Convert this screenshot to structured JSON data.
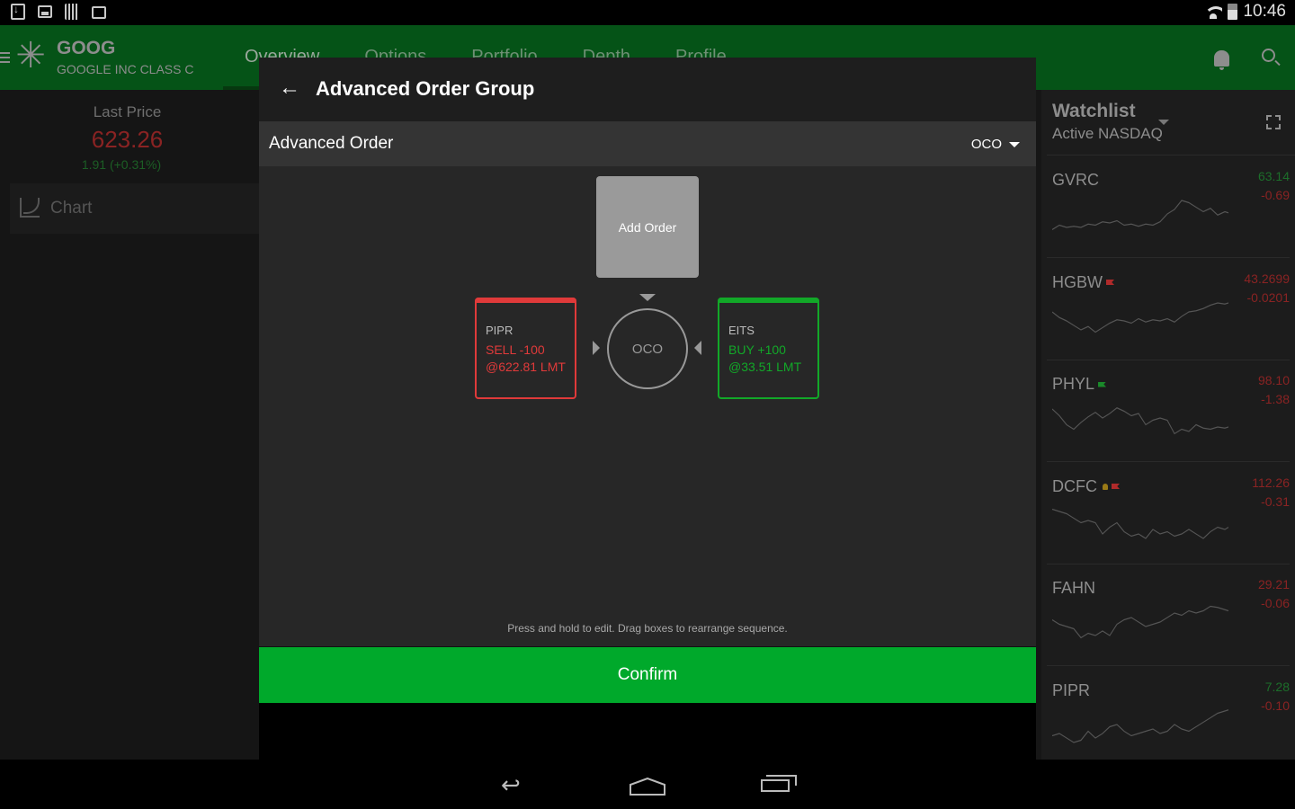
{
  "status_bar": {
    "time": "10:46",
    "left_icons": [
      "download-icon",
      "image-icon",
      "barcode-icon",
      "briefcase-check-icon"
    ],
    "right_icons": [
      "wifi-icon",
      "battery-icon"
    ]
  },
  "app_bar": {
    "ticker": "GOOG",
    "company": "GOOGLE INC CLASS C",
    "tabs": [
      {
        "label": "Overview",
        "active": true
      },
      {
        "label": "Options"
      },
      {
        "label": "Portfolio"
      },
      {
        "label": "Depth"
      },
      {
        "label": "Profile"
      }
    ]
  },
  "left_panel": {
    "last_price_label": "Last Price",
    "last_price": "623.26",
    "change": "1.91 (+0.31%)",
    "chart_label": "Chart"
  },
  "modal": {
    "title": "Advanced Order Group",
    "advanced_order_label": "Advanced Order",
    "order_type_selected": "OCO",
    "add_order_label": "Add Order",
    "center_label": "OCO",
    "orders": [
      {
        "symbol": "PIPR",
        "action": "SELL -100",
        "price": "@622.81 LMT",
        "side": "sell"
      },
      {
        "symbol": "EITS",
        "action": "BUY +100",
        "price": "@33.51 LMT",
        "side": "buy"
      }
    ],
    "hint": "Press and hold to edit. Drag boxes to rearrange sequence.",
    "confirm_label": "Confirm"
  },
  "watchlist": {
    "title": "Watchlist",
    "subtitle": "Active NASDAQ",
    "items": [
      {
        "symbol": "GVRC",
        "price": "63.14",
        "change": "-0.69",
        "price_color": "#1c6e2a",
        "flags": []
      },
      {
        "symbol": "HGBW",
        "price": "43.2699",
        "change": "-0.0201",
        "price_color": "#8a2323",
        "flags": [
          "red-flag"
        ]
      },
      {
        "symbol": "PHYL",
        "price": "98.10",
        "change": "-1.38",
        "price_color": "#8a2323",
        "flags": [
          "green-flag"
        ]
      },
      {
        "symbol": "DCFC",
        "price": "112.26",
        "change": "-0.31",
        "price_color": "#8a2323",
        "flags": [
          "bell",
          "red-flag"
        ]
      },
      {
        "symbol": "FAHN",
        "price": "29.21",
        "change": "-0.06",
        "price_color": "#8a2323",
        "flags": []
      },
      {
        "symbol": "PIPR",
        "price": "7.28",
        "change": "-0.10",
        "price_color": "#1c6e2a",
        "flags": []
      }
    ]
  },
  "colors": {
    "app_bar": "#055317",
    "sell": "#e03a3a",
    "buy": "#12a828",
    "confirm": "#00a92b"
  }
}
